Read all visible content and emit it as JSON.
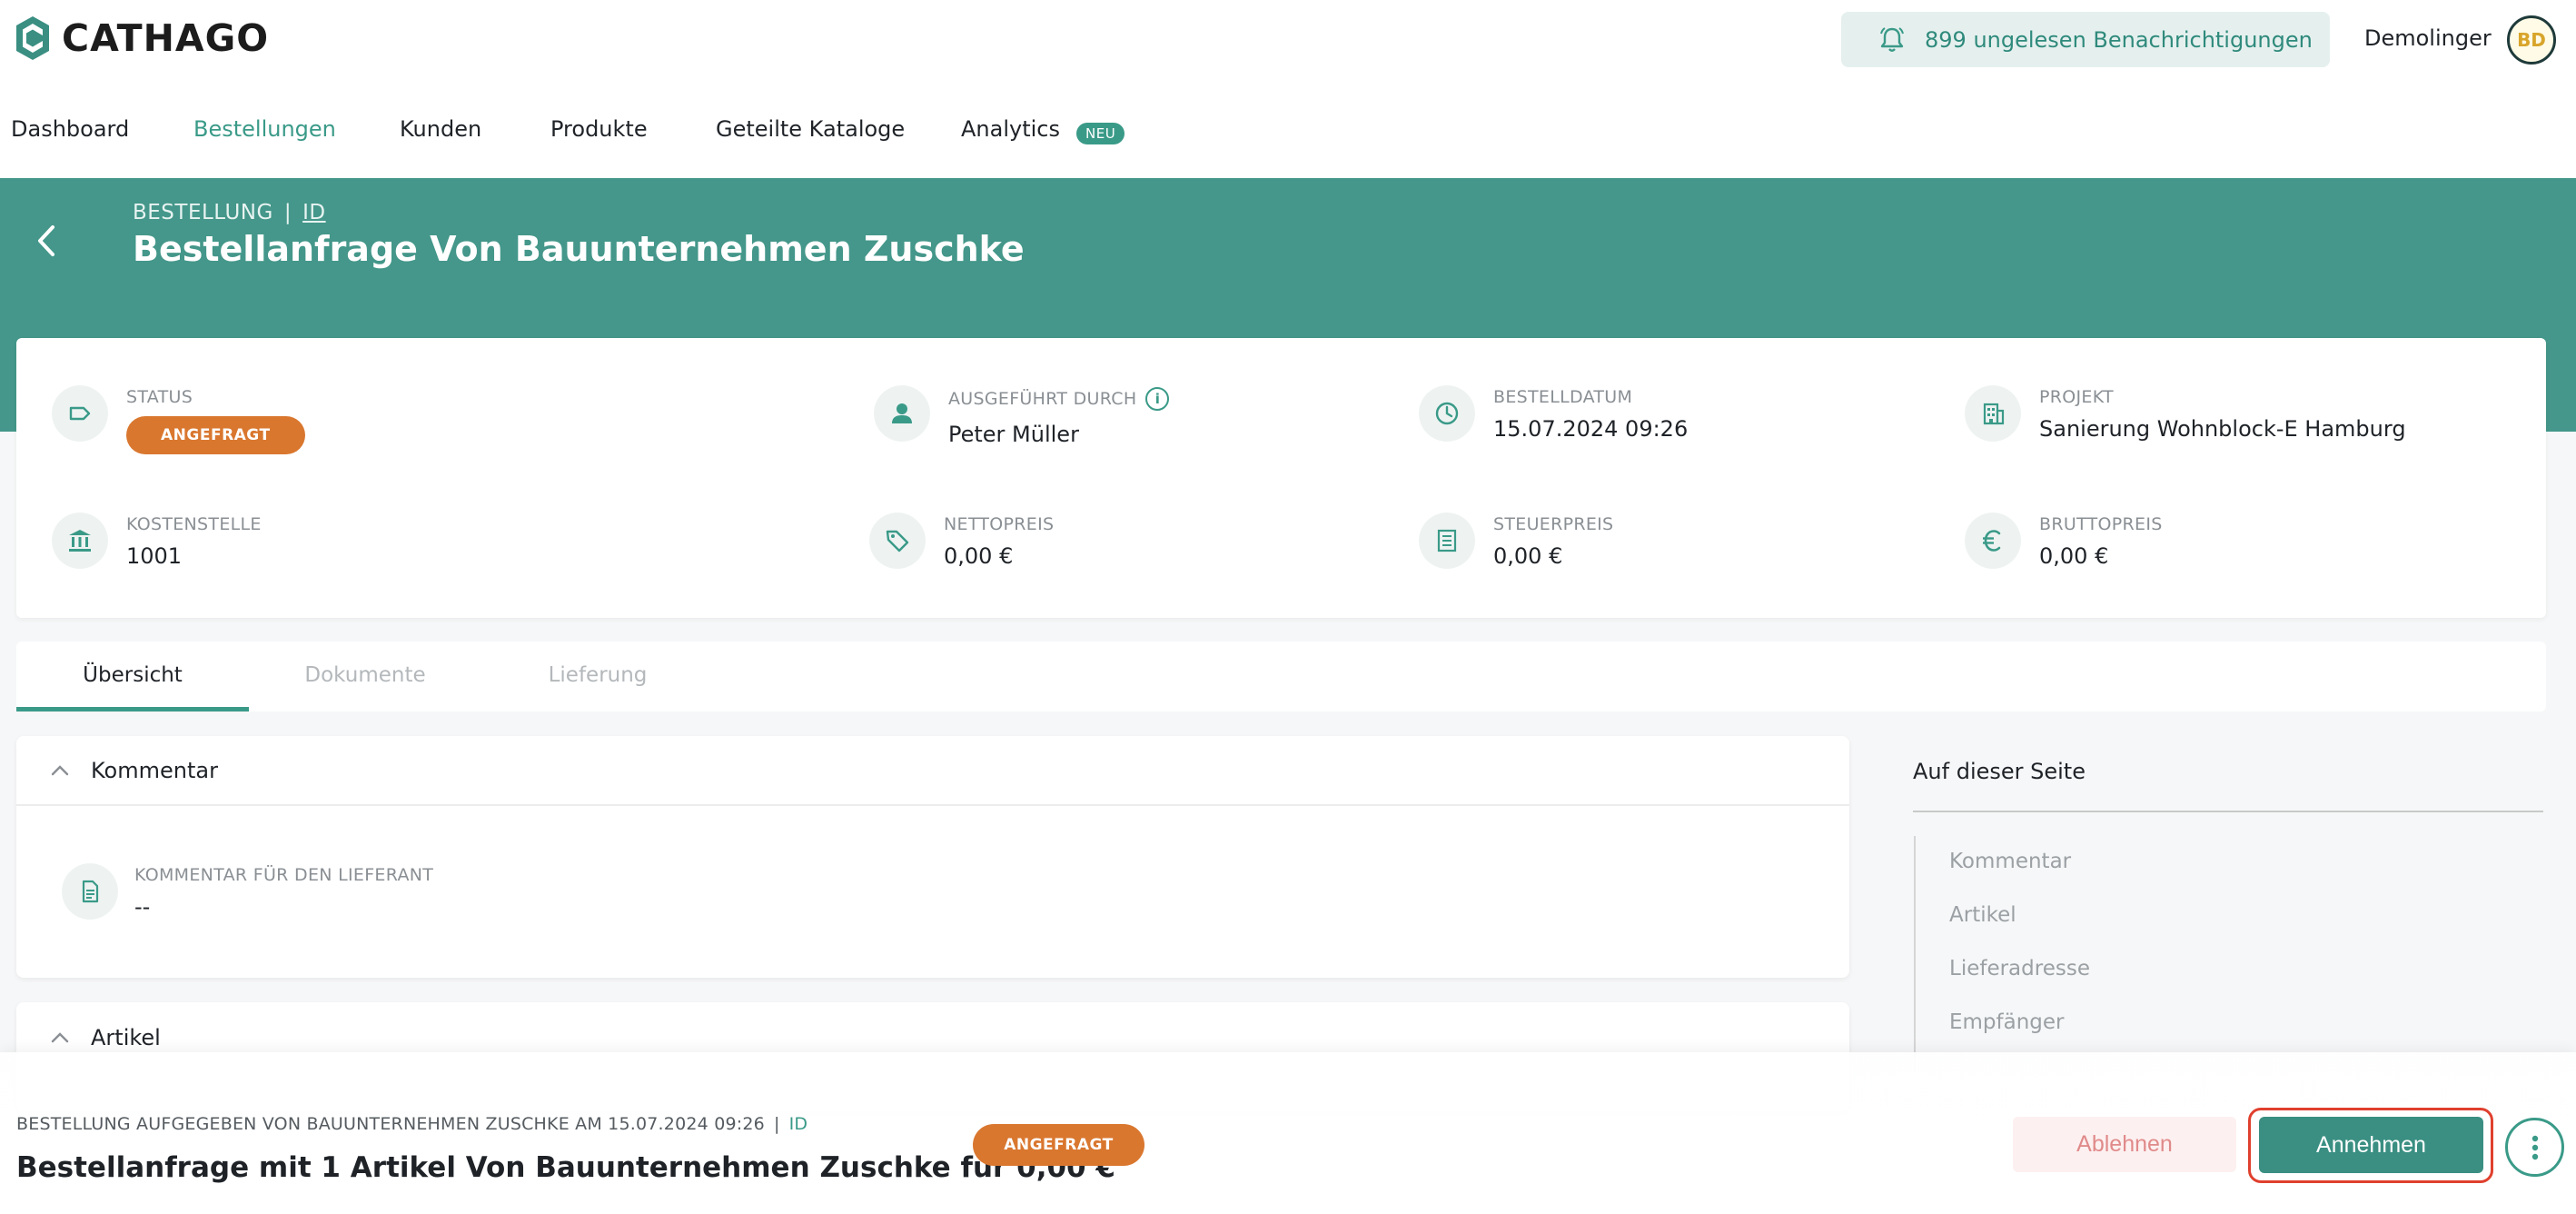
{
  "brand": {
    "name": "CATHAGO",
    "accent": "#44978a",
    "status_color": "#d9772f"
  },
  "header": {
    "notifications": "899 ungelesen Benachrichtigungen",
    "username": "Demolinger",
    "avatar_initials": "BD"
  },
  "nav": {
    "items": [
      "Dashboard",
      "Bestellungen",
      "Kunden",
      "Produkte",
      "Geteilte Kataloge",
      "Analytics"
    ],
    "active": "Bestellungen",
    "analytics_badge": "NEU"
  },
  "breadcrumb": {
    "section": "BESTELLUNG",
    "separator": "|",
    "id_link": "ID"
  },
  "page_title": "Bestellanfrage Von Bauunternehmen Zuschke",
  "info": {
    "status": {
      "label": "STATUS",
      "value": "ANGEFRAGT",
      "icon": "tag-icon"
    },
    "executed_by": {
      "label": "AUSGEFÜHRT DURCH",
      "value": "Peter Müller",
      "icon": "person-icon"
    },
    "order_date": {
      "label": "BESTELLDATUM",
      "value": "15.07.2024 09:26",
      "icon": "clock-icon"
    },
    "project": {
      "label": "PROJEKT",
      "value": "Sanierung Wohnblock-E Hamburg",
      "icon": "building-icon"
    },
    "cost_center": {
      "label": "KOSTENSTELLE",
      "value": "1001",
      "icon": "bank-icon"
    },
    "net_price": {
      "label": "NETTOPREIS",
      "value": "0,00 €",
      "icon": "price-tag-icon"
    },
    "tax_price": {
      "label": "STEUERPREIS",
      "value": "0,00 €",
      "icon": "receipt-icon"
    },
    "gross_price": {
      "label": "BRUTTOPREIS",
      "value": "0,00 €",
      "icon": "euro-icon"
    }
  },
  "tabs": [
    "Übersicht",
    "Dokumente",
    "Lieferung"
  ],
  "active_tab": "Übersicht",
  "comment_section": {
    "title": "Kommentar",
    "field_label": "KOMMENTAR FÜR DEN LIEFERANT",
    "field_value": "--"
  },
  "articles_section": {
    "title": "Artikel"
  },
  "toc": {
    "title": "Auf dieser Seite",
    "items": [
      "Kommentar",
      "Artikel",
      "Lieferadresse",
      "Empfänger"
    ]
  },
  "footer": {
    "subtitle": "BESTELLUNG AUFGEGEBEN VON BAUUNTERNEHMEN ZUSCHKE AM 15.07.2024 09:26",
    "separator": "|",
    "id_link": "ID",
    "title": "Bestellanfrage mit 1 Artikel Von Bauunternehmen Zuschke für 0,00 €",
    "status": "ANGEFRAGT",
    "reject_label": "Ablehnen",
    "accept_label": "Annehmen"
  }
}
